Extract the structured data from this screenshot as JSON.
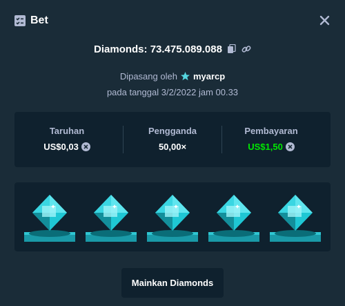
{
  "header": {
    "title": "Bet",
    "icon": "bet-slip-icon",
    "close_icon": "close-icon"
  },
  "diamonds_line": {
    "text": "Diamonds: 73.475.089.088",
    "copy_icon": "copy-icon",
    "link_icon": "link-icon"
  },
  "placed_by": {
    "prefix": "Dipasang oleh",
    "user_icon": "star-icon",
    "username": "myarcp"
  },
  "date_text": "pada tanggal 3/2/2022 jam 00.33",
  "stats": [
    {
      "label": "Taruhan",
      "value": "US$0,03",
      "has_coin": true,
      "color": "#ffffff"
    },
    {
      "label": "Pengganda",
      "value": "50,00×",
      "has_coin": false,
      "color": "#ffffff"
    },
    {
      "label": "Pembayaran",
      "value": "US$1,50",
      "has_coin": true,
      "color": "#00e701"
    }
  ],
  "board": {
    "gems": [
      "diamond",
      "diamond",
      "diamond",
      "diamond",
      "diamond"
    ],
    "gem_icon": "diamond-gem-icon"
  },
  "play_button": {
    "label": "Mainkan Diamonds"
  },
  "colors": {
    "background": "#1a2c38",
    "panel": "#0f212e",
    "muted_text": "#b1bad3",
    "win_green": "#00e701",
    "gem": "#1fc7d4"
  }
}
